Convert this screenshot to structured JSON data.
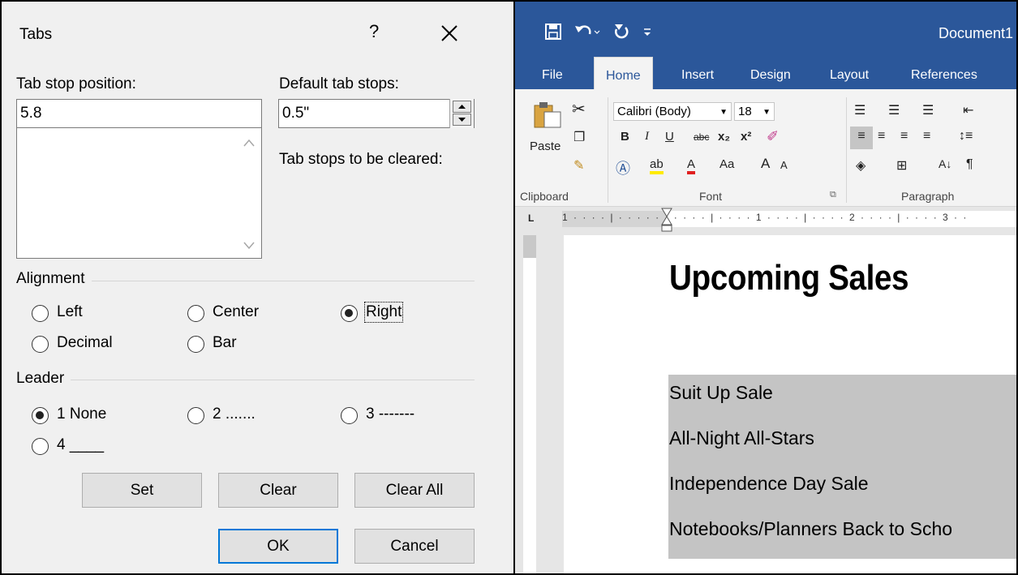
{
  "dialog": {
    "title": "Tabs",
    "help": "?",
    "tab_stop_position_label": "Tab stop position:",
    "tab_stop_position_value": "5.8",
    "default_tab_stops_label": "Default tab stops:",
    "default_tab_stops_value": "0.5\"",
    "tab_stops_cleared_label": "Tab stops to be cleared:",
    "alignment": {
      "title": "Alignment",
      "options": [
        "Left",
        "Center",
        "Right",
        "Decimal",
        "Bar"
      ],
      "selected": "Right"
    },
    "leader": {
      "title": "Leader",
      "options": [
        "1 None",
        "2 .......",
        "3 -------",
        "4 ____"
      ],
      "selected": "1 None"
    },
    "buttons": {
      "set": "Set",
      "clear": "Clear",
      "clear_all": "Clear All",
      "ok": "OK",
      "cancel": "Cancel"
    }
  },
  "word": {
    "document_title": "Document1",
    "ribbon_tabs": [
      "File",
      "Home",
      "Insert",
      "Design",
      "Layout",
      "References"
    ],
    "active_tab": "Home",
    "paste_label": "Paste",
    "font_name": "Calibri (Body)",
    "font_size": "18",
    "group_labels": [
      "Clipboard",
      "Font",
      "Paragraph"
    ],
    "format_buttons": [
      "B",
      "I",
      "U",
      "abc",
      "x₂",
      "x²"
    ],
    "aa_label": "Aa",
    "ruler_text": "1 · · · · | · · · · · · · · · · | · · · · 1 · · · · | · · · · 2 · · · · | · · · · 3 · ·",
    "heading": "Upcoming Sales",
    "lines": [
      "Suit Up Sale",
      "All-Night All-Stars",
      "Independence Day Sale",
      "Notebooks/Planners Back to Scho"
    ]
  },
  "colors": {
    "word_blue": "#2b579a",
    "dialog_bg": "#f0f0f0",
    "highlight_gray": "#c4c4c4",
    "ok_border": "#0078d7"
  }
}
